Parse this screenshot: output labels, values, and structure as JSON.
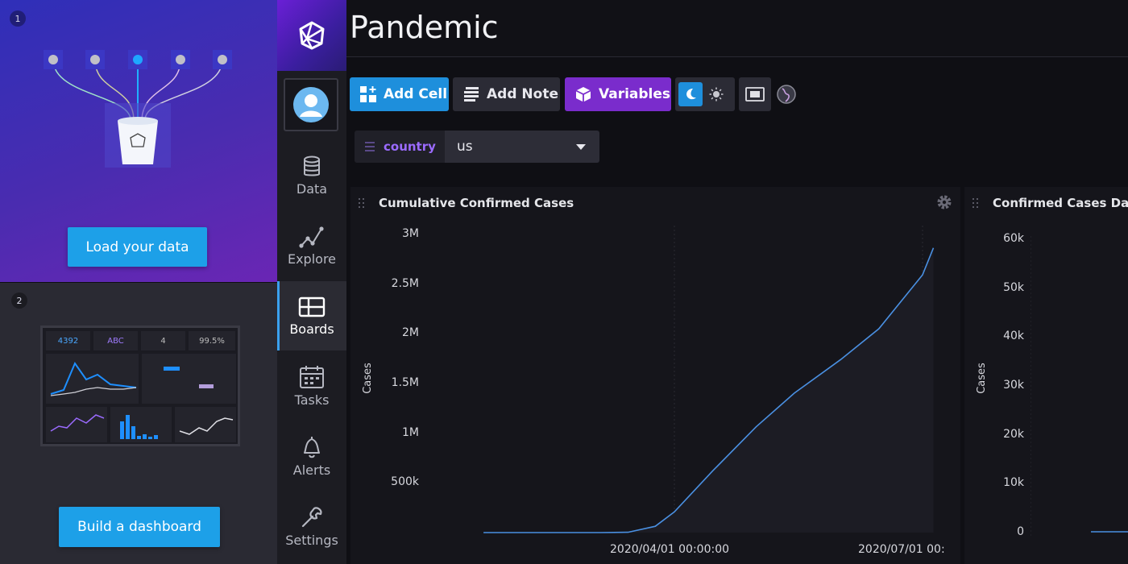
{
  "onboarding": {
    "step1": {
      "number": "1",
      "cta_label": "Load your data"
    },
    "step2": {
      "number": "2",
      "cta_label": "Build a dashboard",
      "mini_stats": [
        "4392",
        "ABC",
        "4",
        "99.5%"
      ]
    }
  },
  "nav": {
    "items": [
      {
        "label": "Data",
        "icon": "database-icon"
      },
      {
        "label": "Explore",
        "icon": "graph-icon"
      },
      {
        "label": "Boards",
        "icon": "dashboards-icon",
        "active": true
      },
      {
        "label": "Tasks",
        "icon": "calendar-icon"
      },
      {
        "label": "Alerts",
        "icon": "bell-icon"
      },
      {
        "label": "Settings",
        "icon": "wrench-icon"
      }
    ]
  },
  "page": {
    "title": "Pandemic"
  },
  "toolbar": {
    "add_cell_label": "Add Cell",
    "add_note_label": "Add Note",
    "variables_label": "Variables",
    "theme": "dark"
  },
  "variables": {
    "name": "country",
    "selected": "us"
  },
  "colors": {
    "accent_blue": "#1e8fdc",
    "accent_purple": "#7a2ccc",
    "line_blue": "#4a90e2"
  },
  "cells": [
    {
      "title": "Cumulative Confirmed Cases",
      "ylabel": "Cases",
      "y_ticks": [
        "3M",
        "2.5M",
        "2M",
        "1.5M",
        "1M",
        "500k"
      ],
      "x_ticks": [
        "2020/04/01 00:00:00",
        "2020/07/01 00:"
      ]
    },
    {
      "title": "Confirmed Cases Dail",
      "ylabel": "Cases",
      "y_ticks": [
        "60k",
        "50k",
        "40k",
        "30k",
        "20k",
        "10k",
        "0"
      ]
    }
  ],
  "chart_data": [
    {
      "type": "area",
      "title": "Cumulative Confirmed Cases",
      "ylabel": "Cases",
      "ylim": [
        0,
        3100000
      ],
      "x": [
        "2020-01-22",
        "2020-02-15",
        "2020-03-05",
        "2020-03-15",
        "2020-03-25",
        "2020-04-01",
        "2020-04-15",
        "2020-05-01",
        "2020-05-15",
        "2020-06-01",
        "2020-06-15",
        "2020-07-01",
        "2020-07-05"
      ],
      "series": [
        {
          "values": [
            1,
            15,
            200,
            3500,
            65000,
            215000,
            640000,
            1100000,
            1450000,
            1800000,
            2120000,
            2680000,
            2960000
          ]
        }
      ]
    },
    {
      "type": "line",
      "title": "Confirmed Cases Dail",
      "ylabel": "Cases",
      "ylim": [
        0,
        62000
      ]
    }
  ]
}
